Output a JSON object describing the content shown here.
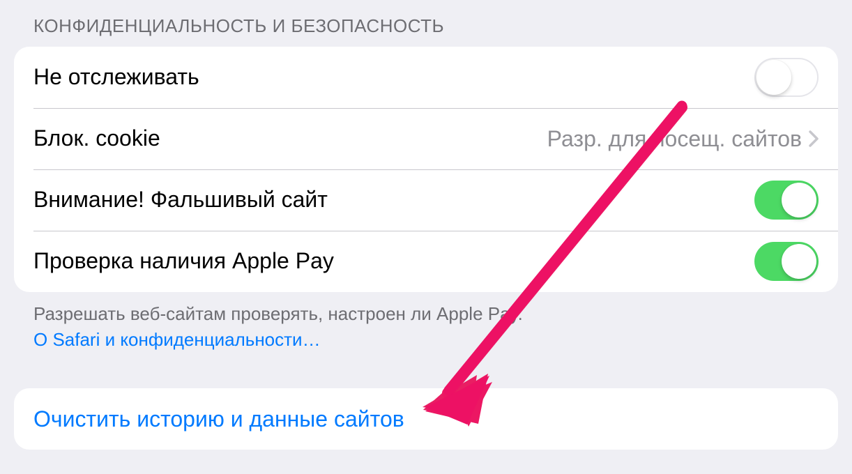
{
  "section": {
    "header": "КОНФИДЕНЦИАЛЬНОСТЬ И БЕЗОПАСНОСТЬ",
    "rows": [
      {
        "label": "Не отслеживать",
        "type": "switch",
        "on": false
      },
      {
        "label": "Блок. cookie",
        "type": "link",
        "value": "Разр. для посещ. сайтов"
      },
      {
        "label": "Внимание! Фальшивый сайт",
        "type": "switch",
        "on": true
      },
      {
        "label": "Проверка наличия Apple Pay",
        "type": "switch",
        "on": true
      }
    ],
    "footer_text": "Разрешать веб-сайтам проверять, настроен ли Apple Pay.",
    "footer_link": "О Safari и конфиденциальности…"
  },
  "action": {
    "label": "Очистить историю и данные сайтов"
  }
}
